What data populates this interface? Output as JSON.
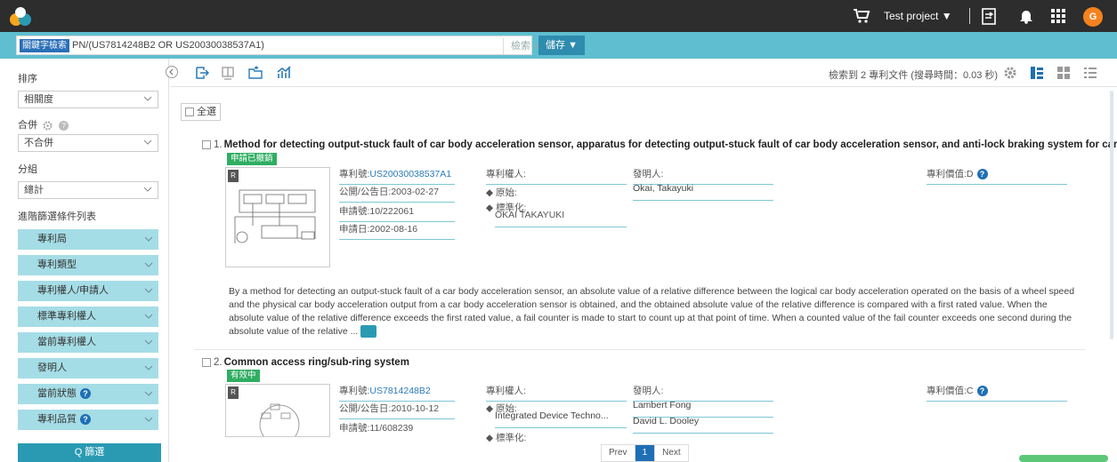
{
  "topbar": {
    "project_label": "Test project ▼",
    "avatar_letter": "G",
    "avatar_color": "#f5821f"
  },
  "search": {
    "mode_tag": "關鍵字檢索",
    "query": "PN/(US7814248B2 OR US20030038537A1)",
    "search_label": "檢索 ∨",
    "save_label": "儲存 ▼"
  },
  "sidebar": {
    "sort_label": "排序",
    "sort_value": "相關度",
    "merge_label": "合併",
    "merge_value": "不合併",
    "group_label": "分組",
    "group_value": "總計",
    "advanced_label": "進階篩選條件列表",
    "filters": [
      {
        "label": "專利局",
        "help": false
      },
      {
        "label": "專利類型",
        "help": false
      },
      {
        "label": "專利權人/申請人",
        "help": false
      },
      {
        "label": "標準專利權人",
        "help": false
      },
      {
        "label": "當前專利權人",
        "help": false
      },
      {
        "label": "發明人",
        "help": false
      },
      {
        "label": "當前狀態",
        "help": true
      },
      {
        "label": "專利品質",
        "help": true
      }
    ],
    "filter_button": "Q 篩選"
  },
  "toolbar": {
    "result_count": "檢索到 2 專利文件 (搜尋時間：0.03 秒)"
  },
  "results": {
    "select_all": "全選",
    "items": [
      {
        "index": "1.",
        "title": "Method for detecting output-stuck fault of car body acceleration sensor, apparatus for detecting output-stuck fault of car body acceleration sensor, and anti-lock braking system for car",
        "status": "申請已撤銷",
        "status_color": "#2fae62",
        "patent_no_label": "專利號:",
        "patent_no": "US20030038537A1",
        "pub_date": "公開/公告日:2003-02-27",
        "app_no": "申請號:10/222061",
        "app_date": "申請日:2002-08-16",
        "assignee_label": "專利權人:",
        "orig_label": "◆ 原始:",
        "orig_value": "",
        "std_label": "◆ 標準化:",
        "std_value": "OKAI TAKAYUKI",
        "inventor_label": "發明人:",
        "inventors": [
          "Okai, Takayuki"
        ],
        "value_label": "專利價值:D",
        "abstract": "By a method for detecting an output-stuck fault of a car body acceleration sensor, an absolute value of a relative difference between the logical car body acceleration operated on the basis of a wheel speed and the physical car body acceleration output from a car body acceleration sensor is obtained, and the obtained absolute value of the relative difference is compared with a first rated value. When the absolute value of the relative difference exceeds the first rated value, a fail counter is made to start to count up at that point of time. When a counted value of the fail counter exceeds one second during the absolute value of the relative ..."
      },
      {
        "index": "2.",
        "title": "Common access ring/sub-ring system",
        "status": "有效中",
        "status_color": "#2fae62",
        "patent_no_label": "專利號:",
        "patent_no": "US7814248B2",
        "pub_date": "公開/公告日:2010-10-12",
        "app_no": "申請號:11/608239",
        "assignee_label": "專利權人:",
        "orig_label": "◆ 原始:",
        "orig_value": "Integrated Device Techno...",
        "std_label": "◆ 標準化:",
        "inventor_label": "發明人:",
        "inventors": [
          "Lambert Fong",
          "David L. Dooley"
        ],
        "value_label": "專利價值:C"
      }
    ]
  },
  "pager": {
    "prev": "Prev",
    "current": "1",
    "next": "Next"
  }
}
